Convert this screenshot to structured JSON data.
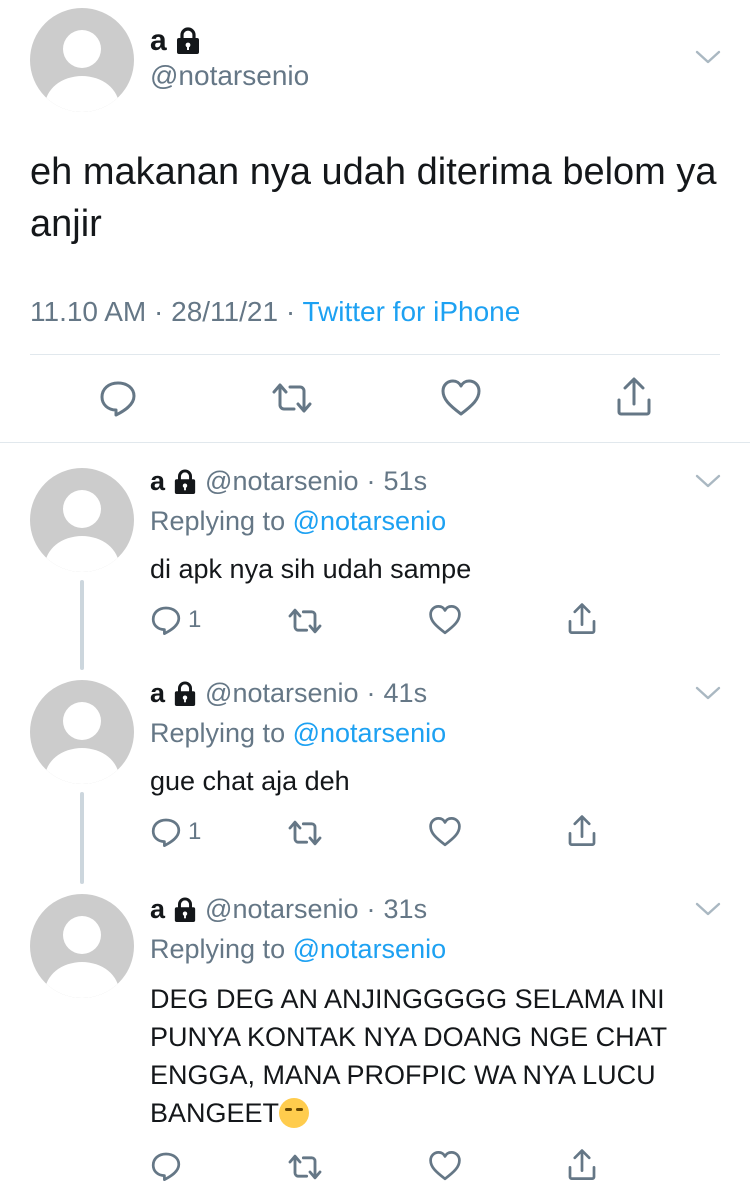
{
  "main_tweet": {
    "name": "a",
    "handle": "@notarsenio",
    "text": "eh makanan nya udah diterima belom ya anjir",
    "time": "11.10 AM",
    "date": "28/11/21",
    "source": "Twitter for iPhone",
    "separator": "·"
  },
  "replies": [
    {
      "name": "a",
      "handle": "@notarsenio",
      "time": "51s",
      "replying_prefix": "Replying to",
      "replying_to": "@notarsenio",
      "text": "di apk nya sih udah sampe",
      "reply_count": "1"
    },
    {
      "name": "a",
      "handle": "@notarsenio",
      "time": "41s",
      "replying_prefix": "Replying to",
      "replying_to": "@notarsenio",
      "text": "gue chat aja deh",
      "reply_count": "1"
    },
    {
      "name": "a",
      "handle": "@notarsenio",
      "time": "31s",
      "replying_prefix": "Replying to",
      "replying_to": "@notarsenio",
      "text": "DEG DEG AN ANJINGGGGG SELAMA INI PUNYA KONTAK NYA DOANG NGE CHAT ENGGA, MANA PROFPIC WA NYA LUCU BANGEET",
      "reply_count": ""
    }
  ],
  "icons": {
    "lock": "lock-icon",
    "chevron": "chevron-down-icon",
    "reply": "reply-icon",
    "retweet": "retweet-icon",
    "like": "heart-icon",
    "share": "share-icon",
    "emoji": "loudly-crying-face-emoji"
  },
  "colors": {
    "link": "#1da1f2",
    "secondary": "#657786",
    "avatar": "#cccccc"
  }
}
